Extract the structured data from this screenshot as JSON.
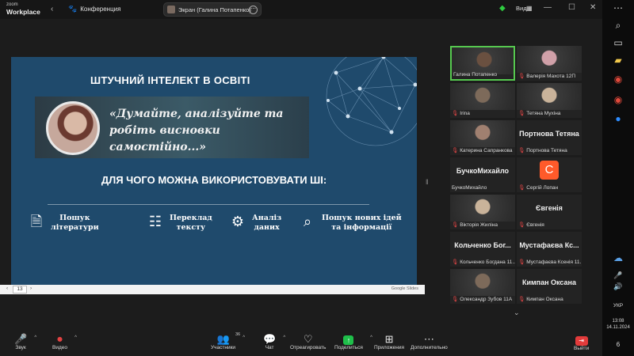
{
  "window": {
    "logo_line1": "zoom",
    "logo_line2": "Workplace",
    "meeting_label": "Конференция",
    "share_label": "Экран (Галина Потапенко)",
    "view_label": "Вид"
  },
  "slide": {
    "title": "ШТУЧНИЙ ІНТЕЛЕКТ В ОСВІТІ",
    "quote": "«Думайте, аналізуйте та робіть висновки самостійно...»",
    "subtitle": "ДЛЯ ЧОГО МОЖНА ВИКОРИСТОВУВАТИ ШІ:",
    "features": [
      {
        "label1": "Пошук",
        "label2": "літератури",
        "icon": "document-icon"
      },
      {
        "label1": "Переклад",
        "label2": "тексту",
        "icon": "checklist-icon"
      },
      {
        "label1": "Аналіз",
        "label2": "даних",
        "icon": "head-gear-icon"
      },
      {
        "label1": "Пошук нових ідей",
        "label2": "та інформації",
        "icon": "magnifier-icon"
      }
    ],
    "page_number": "13",
    "google_slides": "Google Slides"
  },
  "participants": [
    {
      "name": "Галина Потапенко",
      "big": "",
      "muted": false,
      "kind": "video",
      "active": true
    },
    {
      "name": "Валерія Махота 12П",
      "big": "",
      "muted": true,
      "kind": "photo"
    },
    {
      "name": "Irina",
      "big": "",
      "muted": true,
      "kind": "video"
    },
    {
      "name": "Тетяна Мухіна",
      "big": "",
      "muted": true,
      "kind": "video"
    },
    {
      "name": "Катерина Сапранкова",
      "big": "",
      "muted": true,
      "kind": "photo"
    },
    {
      "name": "Портнова Тетяна",
      "big": "Портнова Тетяна",
      "muted": true,
      "kind": "text"
    },
    {
      "name": "БучкоМихайло",
      "big": "БучкоМихайло",
      "muted": false,
      "kind": "text"
    },
    {
      "name": "Сергій Лопан",
      "big": "",
      "muted": true,
      "kind": "avatar",
      "letter": "С"
    },
    {
      "name": "Вікторія Жиліна",
      "big": "",
      "muted": true,
      "kind": "photo"
    },
    {
      "name": "Євгенія",
      "big": "Євгенія",
      "muted": true,
      "kind": "text"
    },
    {
      "name": "Кольченко Богдана 11...",
      "big": "Кольченко Бог...",
      "muted": true,
      "kind": "text"
    },
    {
      "name": "Мустафаєва Ксенія 11...",
      "big": "Мустафаєва Кс...",
      "muted": true,
      "kind": "text"
    },
    {
      "name": "Олександр Зубов 11А",
      "big": "",
      "muted": true,
      "kind": "photo"
    },
    {
      "name": "Кимпан Оксана",
      "big": "Кимпан Оксана",
      "muted": true,
      "kind": "text"
    }
  ],
  "toolbar": {
    "audio": "Звук",
    "video": "Видео",
    "participants": "Участники",
    "participants_count": "36",
    "chat": "Чат",
    "react": "Отреагировать",
    "share": "Поделиться",
    "apps": "Приложения",
    "more": "Дополнительно",
    "leave": "Выйти"
  },
  "taskbar": {
    "lang": "УКР",
    "time": "13:08",
    "date": "14.11.2024",
    "notifications": "6"
  }
}
